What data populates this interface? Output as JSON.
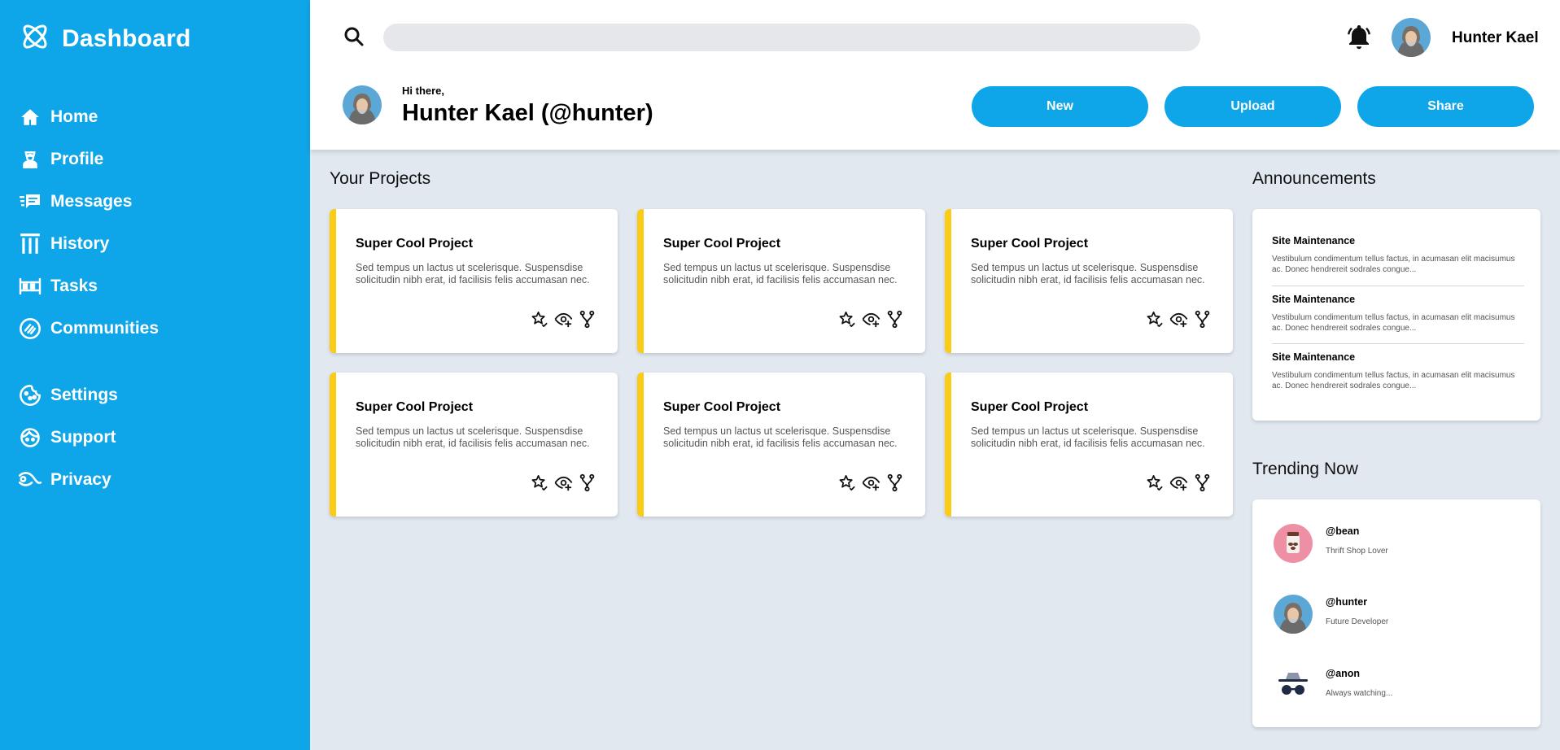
{
  "brand": {
    "title": "Dashboard"
  },
  "sidebar": {
    "items": [
      {
        "label": "Home",
        "icon": "home-icon"
      },
      {
        "label": "Profile",
        "icon": "profile-icon"
      },
      {
        "label": "Messages",
        "icon": "messages-icon"
      },
      {
        "label": "History",
        "icon": "history-icon"
      },
      {
        "label": "Tasks",
        "icon": "tasks-icon"
      },
      {
        "label": "Communities",
        "icon": "communities-icon"
      },
      {
        "label": "Settings",
        "icon": "settings-icon"
      },
      {
        "label": "Support",
        "icon": "support-icon"
      },
      {
        "label": "Privacy",
        "icon": "privacy-icon"
      }
    ]
  },
  "header": {
    "search": {
      "placeholder": "",
      "value": ""
    },
    "user_name": "Hunter Kael",
    "greeting": "Hi there,",
    "full_name": "Hunter Kael (@hunter)",
    "buttons": {
      "new": "New",
      "upload": "Upload",
      "share": "Share"
    }
  },
  "projects": {
    "title": "Your Projects",
    "cards": [
      {
        "title": "Super Cool Project",
        "desc": "Sed tempus un lactus ut scelerisque. Suspensdise solicitudin nibh erat, id facilisis felis accumasan nec."
      },
      {
        "title": "Super Cool Project",
        "desc": "Sed tempus un lactus ut scelerisque. Suspensdise solicitudin nibh erat, id facilisis felis accumasan nec."
      },
      {
        "title": "Super Cool Project",
        "desc": "Sed tempus un lactus ut scelerisque. Suspensdise solicitudin nibh erat, id facilisis felis accumasan nec."
      },
      {
        "title": "Super Cool Project",
        "desc": "Sed tempus un lactus ut scelerisque. Suspensdise solicitudin nibh erat, id facilisis felis accumasan nec."
      },
      {
        "title": "Super Cool Project",
        "desc": "Sed tempus un lactus ut scelerisque. Suspensdise solicitudin nibh erat, id facilisis felis accumasan nec."
      },
      {
        "title": "Super Cool Project",
        "desc": "Sed tempus un lactus ut scelerisque. Suspensdise solicitudin nibh erat, id facilisis felis accumasan nec."
      }
    ]
  },
  "announcements": {
    "title": "Announcements",
    "items": [
      {
        "title": "Site Maintenance",
        "body": "Vestibulum condimentum tellus factus, in acumasan elit macisumus ac. Donec hendrereit sodrales congue..."
      },
      {
        "title": "Site Maintenance",
        "body": "Vestibulum condimentum tellus factus, in acumasan elit macisumus ac. Donec hendrereit sodrales congue..."
      },
      {
        "title": "Site Maintenance",
        "body": "Vestibulum condimentum tellus factus, in acumasan elit macisumus ac. Donec hendrereit sodrales congue..."
      }
    ]
  },
  "trending": {
    "title": "Trending Now",
    "items": [
      {
        "handle": "@bean",
        "subtitle": "Thrift Shop Lover"
      },
      {
        "handle": "@hunter",
        "subtitle": "Future Developer"
      },
      {
        "handle": "@anon",
        "subtitle": "Always watching..."
      }
    ]
  },
  "colors": {
    "accent": "#0ea5e9",
    "card_stripe": "#facc15",
    "background": "#e2e8f0"
  }
}
